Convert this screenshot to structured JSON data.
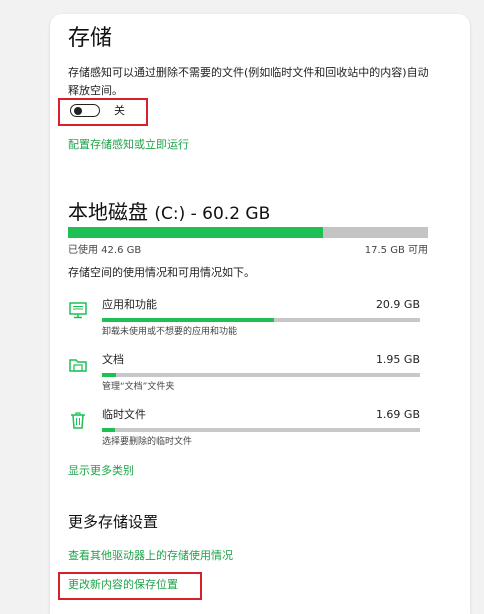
{
  "storage": {
    "title": "存储",
    "description": "存储感知可以通过删除不需要的文件(例如临时文件和回收站中的内容)自动释放空间。",
    "toggle_state_label": "关",
    "toggle_on": false,
    "configure_link": "配置存储感知或立即运行"
  },
  "local_disk": {
    "title": "本地磁盘",
    "drive_suffix": "(C:) - 60.2 GB",
    "used_label": "已使用 42.6 GB",
    "free_label": "17.5 GB 可用",
    "used_fraction": 0.708,
    "summary": "存储空间的使用情况和可用情况如下。"
  },
  "categories": [
    {
      "name": "应用和功能",
      "size": "20.9 GB",
      "desc": "卸载未使用或不想要的应用和功能",
      "fraction": 0.54,
      "icon": "monitor-icon"
    },
    {
      "name": "文档",
      "size": "1.95 GB",
      "desc": "管理“文档”文件夹",
      "fraction": 0.045,
      "icon": "folder-icon"
    },
    {
      "name": "临时文件",
      "size": "1.69 GB",
      "desc": "选择要删除的临时文件",
      "fraction": 0.04,
      "icon": "trash-icon"
    }
  ],
  "show_more_link": "显示更多类别",
  "more_settings": {
    "title": "更多存储设置",
    "other_drives_link": "查看其他驱动器上的存储使用情况",
    "change_save_location_link": "更改新内容的保存位置"
  },
  "colors": {
    "accent": "#1ebf55",
    "link": "#1ea34a",
    "highlight": "#d81f2a"
  }
}
